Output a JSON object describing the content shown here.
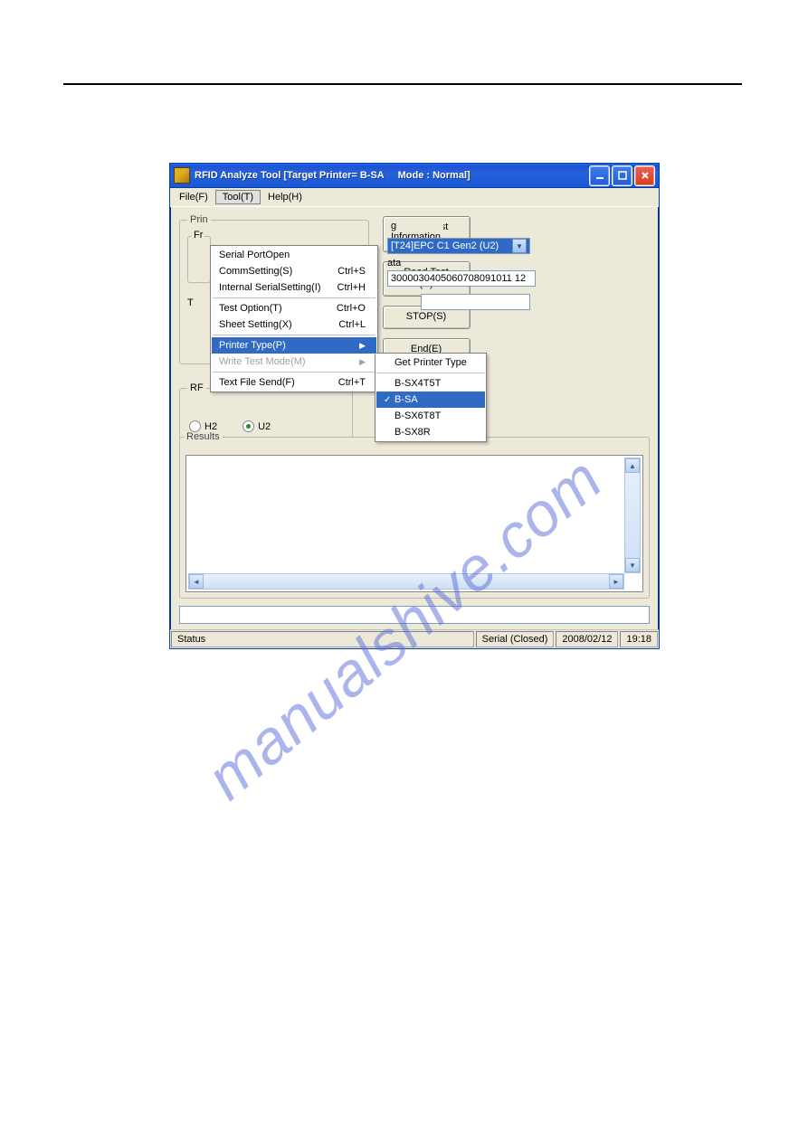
{
  "window": {
    "title": "RFID Analyze Tool [Target Printer= B-SA     Mode : Normal]"
  },
  "menubar": {
    "file": "File(F)",
    "tool": "Tool(T)",
    "help": "Help(H)"
  },
  "toolmenu": {
    "serial_port_open": "Serial PortOpen",
    "comm_setting": "CommSetting(S)",
    "comm_setting_sc": "Ctrl+S",
    "internal_serial": "Internal SerialSetting(I)",
    "internal_serial_sc": "Ctrl+H",
    "test_option": "Test Option(T)",
    "test_option_sc": "Ctrl+O",
    "sheet_setting": "Sheet Setting(X)",
    "sheet_setting_sc": "Ctrl+L",
    "printer_type": "Printer Type(P)",
    "write_test_mode": "Write Test Mode(M)",
    "text_file_send": "Text File Send(F)",
    "text_file_send_sc": "Ctrl+T"
  },
  "submenu": {
    "get_printer_type": "Get Printer Type",
    "b_sx4t5t": "B-SX4T5T",
    "b_sa": "B-SA",
    "b_sx6t8t": "B-SX6T8T",
    "b_sx8r": "B-SX8R"
  },
  "groups": {
    "prin": "Prin",
    "fr": "Fr",
    "t": "T",
    "writing_info": "g Information",
    "ata": "ata :",
    "rf": "RF",
    "results": "Results"
  },
  "tag_select": "[T24]EPC C1 Gen2 (U2)",
  "data_value": "3000030405060708091011 12",
  "radios": {
    "h2": "H2",
    "u2": "U2"
  },
  "buttons": {
    "write_test": "Write Test\n(W)",
    "read_test": "Read Test\n(R)",
    "stop": "STOP(S)",
    "end": "End(E)"
  },
  "statusbar": {
    "status": "Status",
    "serial": "Serial (Closed)",
    "date": "2008/02/12",
    "time": "19:18"
  },
  "watermark": "manualshive.com"
}
